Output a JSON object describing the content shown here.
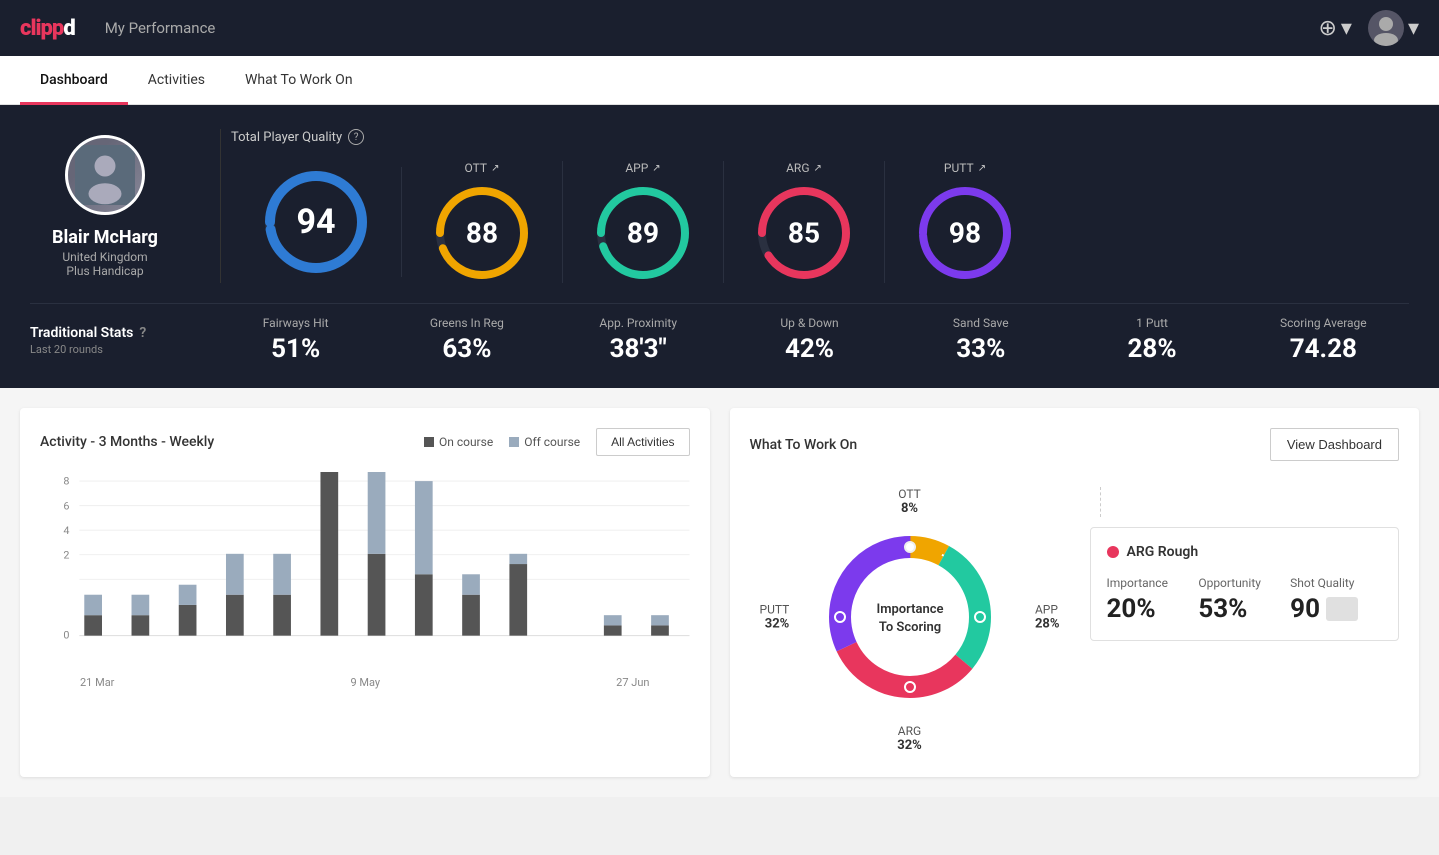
{
  "header": {
    "logo": "clippd",
    "title": "My Performance",
    "add_icon": "⊕",
    "chevron": "▾"
  },
  "tabs": [
    {
      "label": "Dashboard",
      "active": true
    },
    {
      "label": "Activities",
      "active": false
    },
    {
      "label": "What To Work On",
      "active": false
    }
  ],
  "player": {
    "name": "Blair McHarg",
    "country": "United Kingdom",
    "handicap": "Plus Handicap"
  },
  "quality": {
    "label": "Total Player Quality",
    "main_score": 94,
    "main_color": "#2e7bd4",
    "categories": [
      {
        "label": "OTT",
        "score": 88,
        "color": "#f0a500"
      },
      {
        "label": "APP",
        "score": 89,
        "color": "#22c9a0"
      },
      {
        "label": "ARG",
        "score": 85,
        "color": "#e8365d"
      },
      {
        "label": "PUTT",
        "score": 98,
        "color": "#7c3aed"
      }
    ]
  },
  "traditional_stats": {
    "label": "Traditional Stats",
    "sublabel": "Last 20 rounds",
    "items": [
      {
        "name": "Fairways Hit",
        "value": "51%"
      },
      {
        "name": "Greens In Reg",
        "value": "63%"
      },
      {
        "name": "App. Proximity",
        "value": "38'3\""
      },
      {
        "name": "Up & Down",
        "value": "42%"
      },
      {
        "name": "Sand Save",
        "value": "33%"
      },
      {
        "name": "1 Putt",
        "value": "28%"
      },
      {
        "name": "Scoring Average",
        "value": "74.28"
      }
    ]
  },
  "activity_chart": {
    "title": "Activity - 3 Months - Weekly",
    "legend": [
      {
        "label": "On course",
        "color": "#555"
      },
      {
        "label": "Off course",
        "color": "#9aabbd"
      }
    ],
    "all_activities_btn": "All Activities",
    "y_labels": [
      "8",
      "6",
      "4",
      "2",
      "0"
    ],
    "x_labels": [
      "21 Mar",
      "9 May",
      "27 Jun"
    ],
    "bars": [
      {
        "on": 1,
        "off": 1
      },
      {
        "on": 1,
        "off": 1
      },
      {
        "on": 1.5,
        "off": 1
      },
      {
        "on": 2,
        "off": 2
      },
      {
        "on": 2,
        "off": 2
      },
      {
        "on": 8.5,
        "off": 0
      },
      {
        "on": 4,
        "off": 4
      },
      {
        "on": 3,
        "off": 4.5
      },
      {
        "on": 2,
        "off": 1
      },
      {
        "on": 3.5,
        "off": 0.5
      },
      {
        "on": 0,
        "off": 0
      },
      {
        "on": 0.5,
        "off": 0.5
      },
      {
        "on": 0.5,
        "off": 0.5
      }
    ]
  },
  "wtwo": {
    "title": "What To Work On",
    "view_dashboard_btn": "View Dashboard",
    "center_text1": "Importance",
    "center_text2": "To Scoring",
    "segments": [
      {
        "label": "OTT",
        "pct": "8%",
        "color": "#f0a500"
      },
      {
        "label": "APP",
        "pct": "28%",
        "color": "#22c9a0"
      },
      {
        "label": "ARG",
        "pct": "32%",
        "color": "#e8365d"
      },
      {
        "label": "PUTT",
        "pct": "32%",
        "color": "#7c3aed"
      }
    ],
    "detail": {
      "title": "ARG Rough",
      "color": "#e8365d",
      "metrics": [
        {
          "label": "Importance",
          "value": "20%"
        },
        {
          "label": "Opportunity",
          "value": "53%"
        },
        {
          "label": "Shot Quality",
          "value": "90"
        }
      ]
    }
  }
}
